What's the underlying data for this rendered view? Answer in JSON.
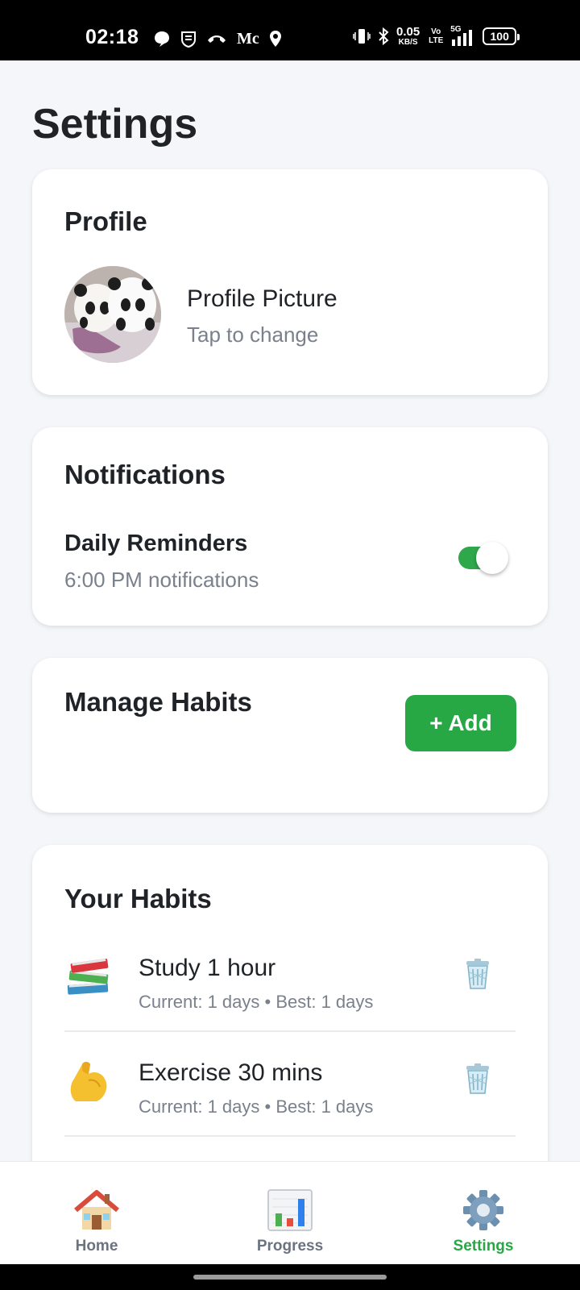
{
  "status_bar": {
    "time": "02:18",
    "speed_value": "0.05",
    "speed_unit": "KB/S",
    "volte_label": "Vo LTE",
    "network_label": "5G",
    "battery": "100",
    "carrier_glyph": "Mc"
  },
  "page": {
    "title": "Settings"
  },
  "profile": {
    "section_title": "Profile",
    "picture_label": "Profile Picture",
    "picture_hint": "Tap to change"
  },
  "notifications": {
    "section_title": "Notifications",
    "daily_label": "Daily Reminders",
    "daily_sub": "6:00 PM notifications",
    "daily_enabled": true
  },
  "manage": {
    "section_title": "Manage Habits",
    "add_label": "+ Add"
  },
  "habits": {
    "section_title": "Your Habits",
    "items": [
      {
        "icon": "books-icon",
        "name": "Study 1 hour",
        "meta": "Current: 1 days • Best: 1 days"
      },
      {
        "icon": "flexed-biceps-icon",
        "name": "Exercise 30 mins",
        "meta": "Current: 1 days • Best: 1 days"
      }
    ]
  },
  "nav": {
    "items": [
      {
        "label": "Home",
        "icon": "house-icon"
      },
      {
        "label": "Progress",
        "icon": "bar-chart-icon"
      },
      {
        "label": "Settings",
        "icon": "gear-icon"
      }
    ],
    "active": "Settings"
  },
  "colors": {
    "accent_green": "#28a745",
    "background": "#f4f6f9",
    "card": "#ffffff",
    "muted_text": "#7a818c"
  }
}
